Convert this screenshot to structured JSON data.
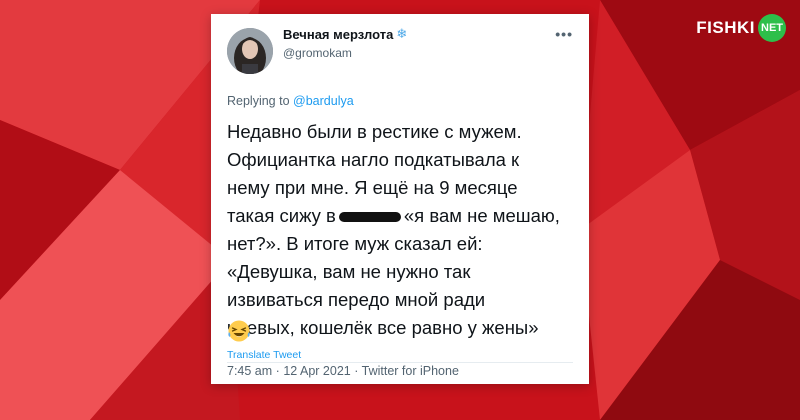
{
  "brand": {
    "word": "FISHKI",
    "badge": "NET"
  },
  "tweet": {
    "display_name": "Вечная мерзлота",
    "name_emoji": "❄",
    "handle": "@gromokam",
    "more": "•••",
    "reply_prefix": "Replying to",
    "reply_to": "@bardulya",
    "text_before_redaction": "Недавно были в рестике с мужем.\nОфициантка нагло подкатывала к\nнему при мне. Я ещё на 9 месяце\nтакая сижу в",
    "text_after_redaction": "«я вам не мешаю,\nнет?». В итоге муж сказал ей:\n«Девушка, вам не нужно так\nизвиваться передо мной ради\nчаевых, кошелёк все равно у жены»",
    "translate_label": "Translate Tweet",
    "time": "7:45 am",
    "date": "12 Apr 2021",
    "source": "Twitter for iPhone",
    "separator": "·"
  },
  "colors": {
    "accent_link": "#1d9bf0",
    "background_red": "#c8121b",
    "brand_badge": "#2dbf4a"
  }
}
